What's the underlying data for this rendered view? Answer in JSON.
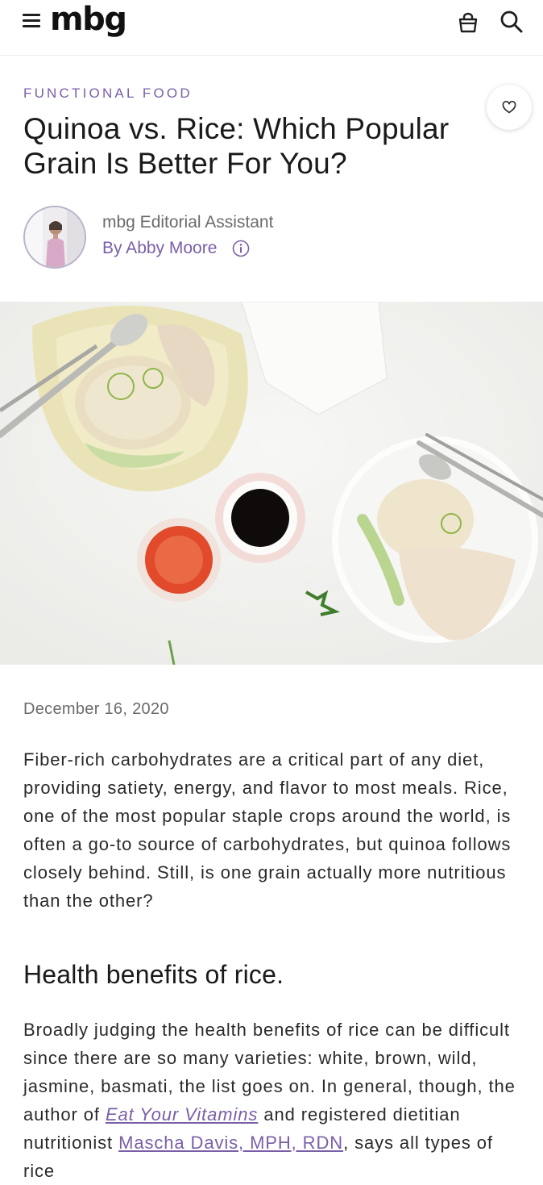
{
  "header": {
    "logo": "mbg",
    "menu_icon": "hamburger-menu-icon",
    "bag_icon": "shopping-bag-icon",
    "search_icon": "search-icon"
  },
  "article": {
    "kicker": "FUNCTIONAL FOOD",
    "title": "Quinoa vs. Rice: Which Popular Grain Is Better For You?",
    "save_icon": "heart-icon",
    "author": {
      "role": "mbg Editorial Assistant",
      "name": "By Abby Moore",
      "info_icon": "info-icon"
    },
    "date": "December 16, 2020",
    "intro": "Fiber-rich carbohydrates are a critical part of any diet, providing satiety, energy, and flavor to most meals. Rice, one of the most popular staple crops around the world, is often a go-to source of carbohydrates, but quinoa follows closely behind. Still, is one grain actually more nutritious than the other?",
    "section_heading": "Health benefits of rice.",
    "section_para_start": "Broadly judging the health benefits of rice can be difficult since there are so many varieties: white, brown, wild, jasmine, basmati, the list goes on. In general, though, the author of ",
    "book_link": "Eat Your Vitamins",
    "section_para_mid": " and registered dietitian nutritionist ",
    "person_link": "Mascha Davis, MPH, RDN",
    "section_para_end": ", says all types of rice"
  },
  "colors": {
    "accent": "#7a5fa8",
    "text": "#2a2a2a",
    "muted": "#6b6b6b"
  }
}
